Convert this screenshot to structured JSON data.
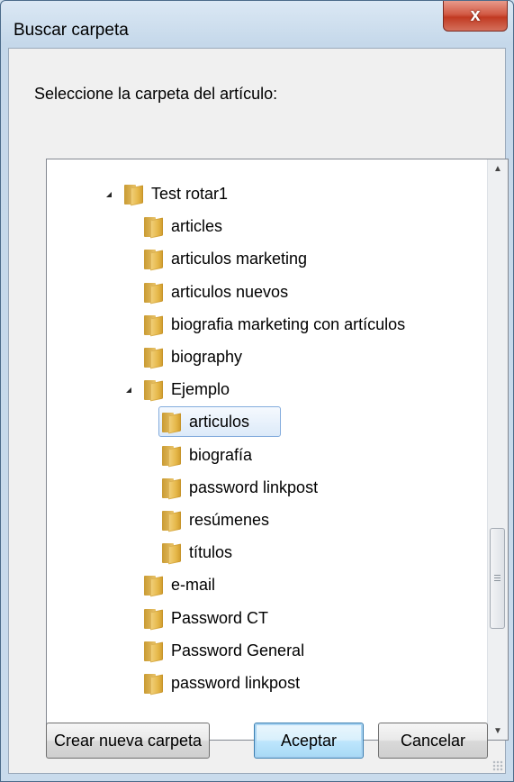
{
  "window": {
    "title": "Buscar carpeta",
    "close_label": "x"
  },
  "dialog": {
    "instruction": "Seleccione la carpeta del artículo:"
  },
  "tree": {
    "items": [
      {
        "label": "Test rotar1",
        "level": 0,
        "expanded": true
      },
      {
        "label": "articles",
        "level": 1
      },
      {
        "label": "articulos marketing",
        "level": 1
      },
      {
        "label": "articulos nuevos",
        "level": 1
      },
      {
        "label": "biografia marketing con artículos",
        "level": 1
      },
      {
        "label": "biography",
        "level": 1
      },
      {
        "label": "Ejemplo",
        "level": 1,
        "expanded": true
      },
      {
        "label": "articulos",
        "level": 2,
        "selected": true
      },
      {
        "label": "biografía",
        "level": 2
      },
      {
        "label": "password linkpost",
        "level": 2
      },
      {
        "label": "resúmenes",
        "level": 2
      },
      {
        "label": "títulos",
        "level": 2
      },
      {
        "label": "e-mail",
        "level": 1
      },
      {
        "label": "Password CT",
        "level": 1
      },
      {
        "label": "Password General",
        "level": 1
      },
      {
        "label": "password linkpost",
        "level": 1
      }
    ]
  },
  "buttons": {
    "new_folder": "Crear nueva carpeta",
    "ok": "Aceptar",
    "cancel": "Cancelar"
  }
}
